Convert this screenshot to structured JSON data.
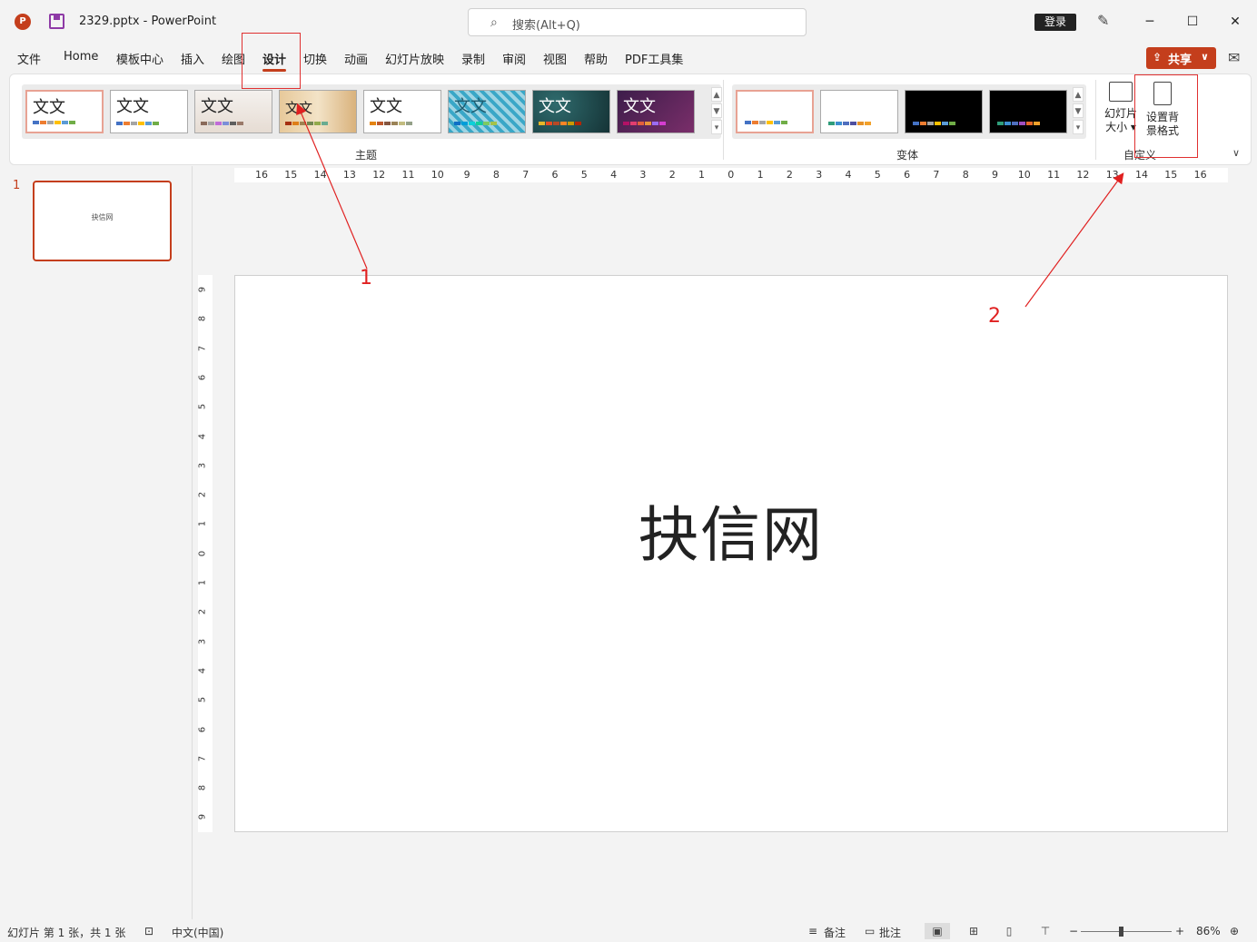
{
  "titlebar": {
    "doc_title": "2329.pptx  -  PowerPoint",
    "search_placeholder": "搜索(Alt+Q)",
    "login_label": "登录",
    "minimize": "─",
    "maximize": "☐",
    "close": "✕"
  },
  "menu": {
    "tabs": [
      "文件",
      "Home",
      "模板中心",
      "插入",
      "绘图",
      "设计",
      "切换",
      "动画",
      "幻灯片放映",
      "录制",
      "审阅",
      "视图",
      "帮助",
      "PDF工具集"
    ],
    "active_tab": "设计",
    "share_label": "共享"
  },
  "ribbon": {
    "themes_group_label": "主题",
    "themes": [
      {
        "label": "文文",
        "selected": true
      },
      {
        "label": "文文"
      },
      {
        "label": "文文"
      },
      {
        "label": "文文"
      },
      {
        "label": "文文"
      },
      {
        "label": "文文"
      },
      {
        "label": "文文"
      },
      {
        "label": "文文"
      }
    ],
    "variants_group_label": "变体",
    "customize_group_label": "自定义",
    "slide_size_label_1": "幻灯片",
    "slide_size_label_2": "大小 ▾",
    "format_bg_label_1": "设置背",
    "format_bg_label_2": "景格式"
  },
  "thumbnails": {
    "slide_number": "1",
    "slide_text": "抉信网"
  },
  "rulers": {
    "horizontal": [
      "16",
      "15",
      "14",
      "13",
      "12",
      "11",
      "10",
      "9",
      "8",
      "7",
      "6",
      "5",
      "4",
      "3",
      "2",
      "1",
      "0",
      "1",
      "2",
      "3",
      "4",
      "5",
      "6",
      "7",
      "8",
      "9",
      "10",
      "11",
      "12",
      "13",
      "14",
      "15",
      "16"
    ],
    "vertical": [
      "9",
      "8",
      "7",
      "6",
      "5",
      "4",
      "3",
      "2",
      "1",
      "0",
      "1",
      "2",
      "3",
      "4",
      "5",
      "6",
      "7",
      "8",
      "9"
    ]
  },
  "slide": {
    "title": "抉信网"
  },
  "annotations": {
    "label_1": "1",
    "label_2": "2",
    "color": "#e02020"
  },
  "statusbar": {
    "slide_info": "幻灯片 第 1 张，共 1 张",
    "language": "中文(中国)",
    "notes_label": "备注",
    "comments_label": "批注",
    "zoom_minus": "−",
    "zoom_plus": "+",
    "zoom_level": "86%"
  },
  "colors": {
    "accent": "#c43e1c"
  }
}
